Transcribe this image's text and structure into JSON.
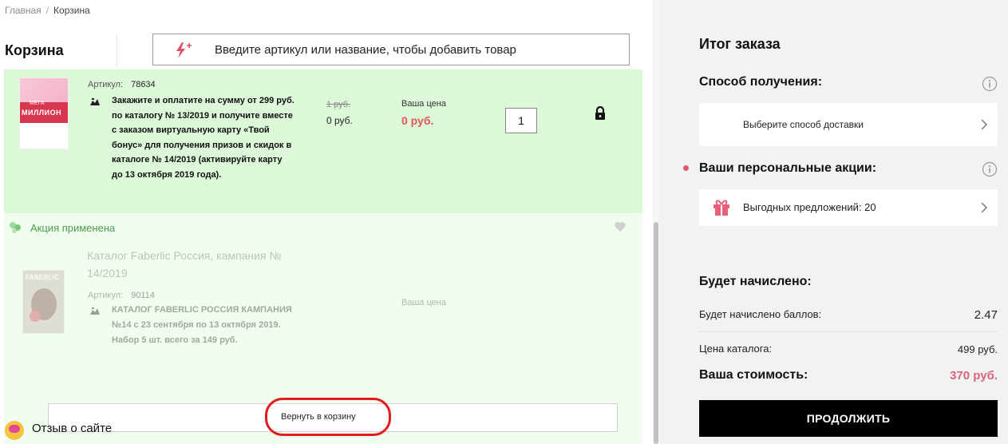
{
  "breadcrumb": {
    "home": "Главная",
    "separator": "/",
    "current": "Корзина"
  },
  "page_title": "Корзина",
  "quick_add": {
    "placeholder": "Введите артикул или название, чтобы добавить товар"
  },
  "cart_item_active": {
    "article_label": "Артикул:",
    "article_value": "78634",
    "description": "Закажите и оплатите на сумму от 299 руб. по каталогу № 13/2019 и получите вместе с заказом виртуальную карту «Твой бонус» для получения призов и скидок в каталоге № 14/2019 (активируйте карту до 13 октября 2019 года).",
    "old_price": "1 руб.",
    "catalog_price": "0 руб.",
    "your_price_label": "Ваша цена",
    "your_price": "0 руб.",
    "quantity": "1",
    "thumbnail_text": "МИЛЛИОН",
    "thumbnail_top_text": "МЕГА"
  },
  "promo_applied": {
    "label": "Акция применена"
  },
  "cart_item_removed": {
    "title": "Каталог Faberlic Россия, кампания № 14/2019",
    "article_label": "Артикул:",
    "article_value": "90114",
    "description": "КАТАЛОГ FABERLIC РОССИЯ КАМПАНИЯ №14 с 23 сентября по 13 октября 2019. Набор 5 шт. всего за 149 руб.",
    "your_price_label": "Ваша цена",
    "thumbnail_logo": "FABERLIC",
    "restore_label": "Вернуть в корзину"
  },
  "feedback": {
    "label": "Отзыв о сайте"
  },
  "summary": {
    "title": "Итог заказа",
    "delivery_heading": "Способ получения:",
    "delivery_select": "Выберите способ доставки",
    "promos_heading": "Ваши персональные акции:",
    "promos_offer": "Выгодных предложений: 20",
    "accrual_heading": "Будет начислено:",
    "points_label": "Будет начислено баллов:",
    "points_value": "2.47",
    "catalog_price_label": "Цена каталога:",
    "catalog_price_value": "499 руб.",
    "total_label": "Ваша стоимость:",
    "total_value": "370 руб.",
    "continue_label": "ПРОДОЛЖИТЬ"
  },
  "colors": {
    "accent_pink": "#d9667a",
    "price_red": "#e0585a",
    "promo_green": "#4c9b4c",
    "highlight_red": "#e01c1c"
  }
}
